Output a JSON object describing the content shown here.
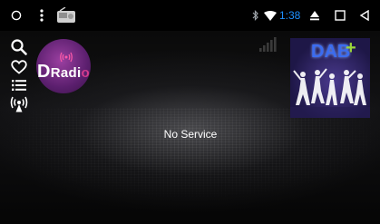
{
  "status_bar": {
    "time": "1:38",
    "icons": {
      "home": "circle-home-icon",
      "menu": "vertical-dots-icon",
      "app": "radio-app-icon",
      "bluetooth": "bluetooth-icon",
      "wifi": "wifi-icon",
      "eject": "eject-icon",
      "recents": "square-recents-icon",
      "back": "triangle-back-icon"
    },
    "accent_color": "#1e90ff"
  },
  "sidebar": {
    "items": [
      {
        "name": "search-icon"
      },
      {
        "name": "favorite-heart-icon"
      },
      {
        "name": "list-icon"
      },
      {
        "name": "scan-antenna-icon"
      }
    ]
  },
  "station_logo": {
    "text_d": "D",
    "text_rad": "Radi",
    "text_o": "o",
    "colors": {
      "bg": "#5b1f6e",
      "accent": "#d23b8c"
    }
  },
  "album_art": {
    "title": "DAB",
    "plus": "+"
  },
  "signal_strength_bars": 0,
  "status_message": "No Service"
}
